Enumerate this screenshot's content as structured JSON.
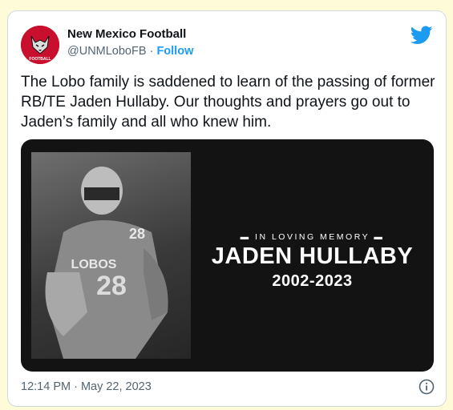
{
  "tweet": {
    "author_name": "New Mexico Football",
    "handle": "@UNMLoboFB",
    "separator": "·",
    "follow_label": "Follow",
    "text": "The Lobo family is saddened to learn of the passing of former RB/TE Jaden Hullaby. Our thoughts and prayers go out to Jaden’s family and all who knew him.",
    "timestamp": "12:14 PM · May 22, 2023"
  },
  "avatar": {
    "caption": "FOOTBALL",
    "icon": "lobo-logo"
  },
  "media": {
    "label": "IN LOVING MEMORY",
    "name": "JADEN HULLABY",
    "years": "2002-2023",
    "jersey_number": "28",
    "jersey_text": "LOBOS"
  },
  "icons": {
    "brand": "twitter-bird-icon",
    "info": "info-icon"
  },
  "colors": {
    "accent": "#1d9bf0",
    "avatar_bg": "#c8102e",
    "page_bg": "#fdfbd8"
  }
}
